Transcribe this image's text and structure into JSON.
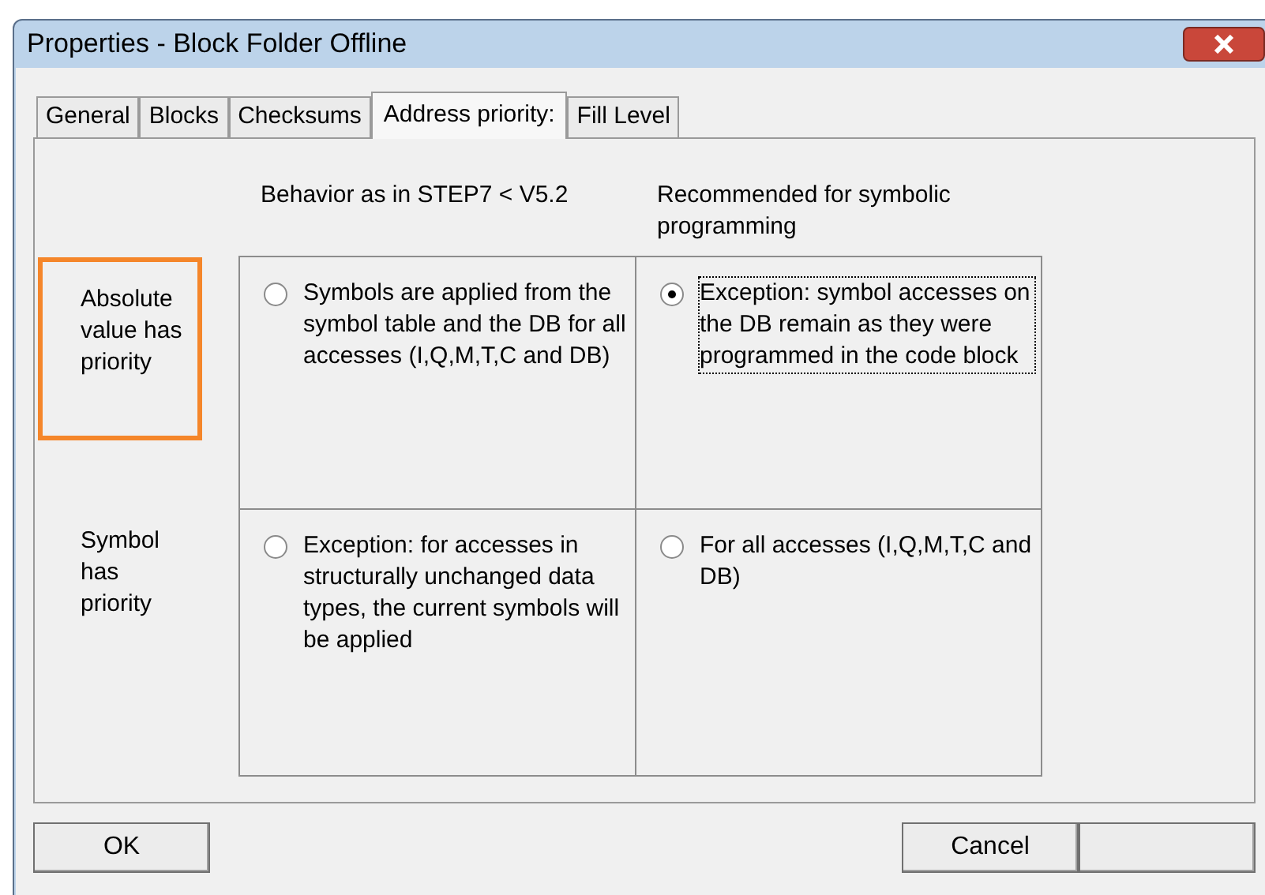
{
  "window": {
    "title": "Properties - Block Folder Offline"
  },
  "tabs": [
    {
      "label": "General",
      "selected": false
    },
    {
      "label": "Blocks",
      "selected": false
    },
    {
      "label": "Checksums",
      "selected": false
    },
    {
      "label": "Address priority:",
      "selected": true
    },
    {
      "label": "Fill Level",
      "selected": false
    }
  ],
  "column_headers": [
    "Behavior as in STEP7 < V5.2",
    "Recommended for symbolic programming"
  ],
  "rows": [
    {
      "label": "Absolute value has priority",
      "highlighted": true,
      "options": [
        {
          "text": "Symbols are applied from the symbol table and the DB for all accesses (I,Q,M,T,C and DB)",
          "selected": false,
          "focused": false
        },
        {
          "text": "Exception: symbol accesses on the DB remain as they were programmed in the code block",
          "selected": true,
          "focused": true
        }
      ]
    },
    {
      "label": "Symbol has priority",
      "highlighted": false,
      "options": [
        {
          "text": "Exception: for accesses in structurally unchanged data types, the current symbols will be applied",
          "selected": false,
          "focused": false
        },
        {
          "text": "For all accesses (I,Q,M,T,C and DB)",
          "selected": false,
          "focused": false
        }
      ]
    }
  ],
  "buttons": [
    {
      "kind": "text",
      "label": "OK"
    },
    {
      "kind": "text",
      "label": "Cancel"
    },
    {
      "kind": "blank"
    }
  ]
}
